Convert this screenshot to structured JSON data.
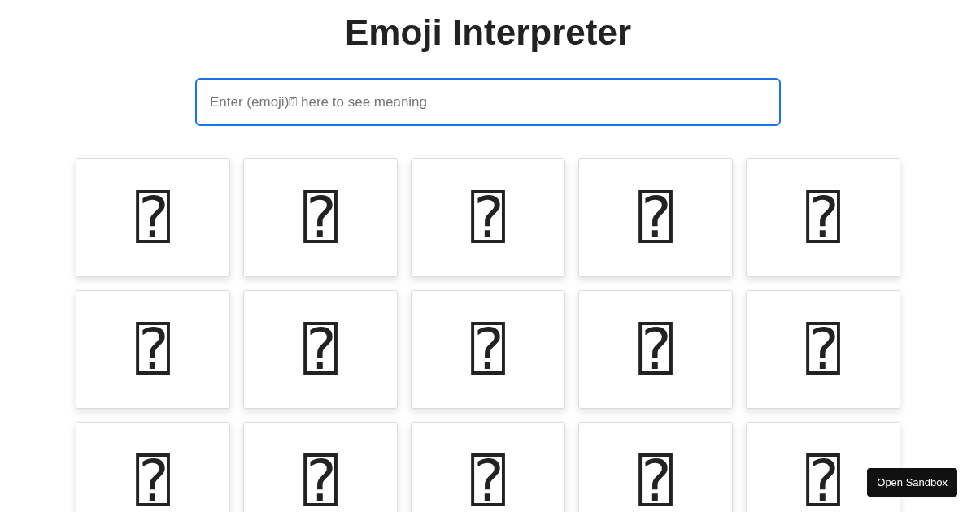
{
  "title": "Emoji Interpreter",
  "search": {
    "placeholder": "Enter (emoji)⍰ here to see meaning"
  },
  "emojis": [
    "⍰",
    "⍰",
    "⍰",
    "⍰",
    "⍰",
    "⍰",
    "⍰",
    "⍰",
    "⍰",
    "⍰",
    "⍰",
    "⍰",
    "⍰",
    "⍰",
    "⍰"
  ],
  "sandbox_button": "Open Sandbox"
}
